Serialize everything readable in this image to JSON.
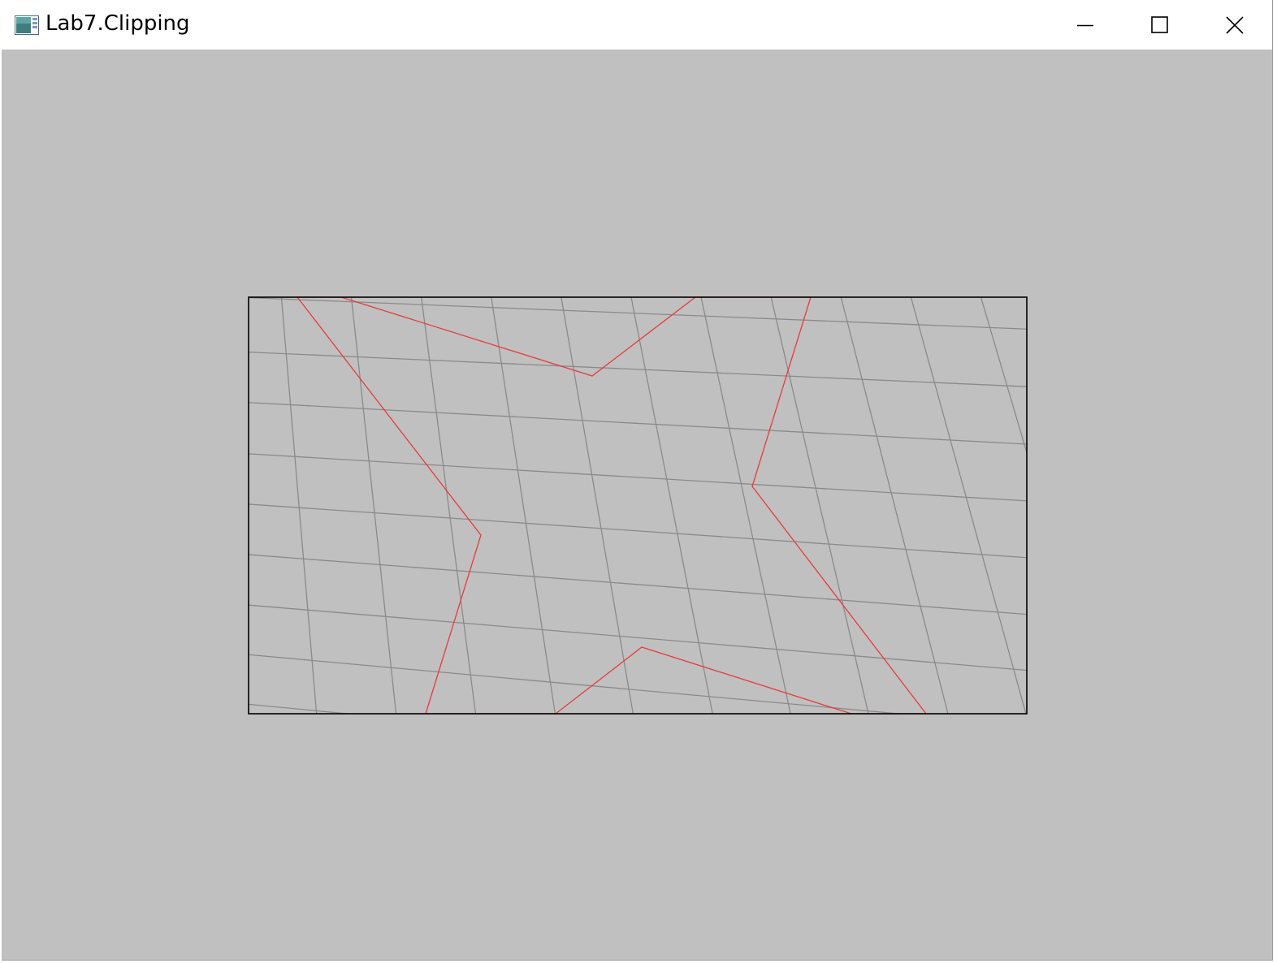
{
  "window": {
    "title": "Lab7.Clipping",
    "icon": "app-window-icon",
    "controls": {
      "minimize_icon": "minimize-icon",
      "maximize_icon": "maximize-icon",
      "close_icon": "close-icon"
    }
  },
  "colors": {
    "client_background": "#c0c0c0",
    "grid_lines": "#8a8a8a",
    "clipped_polygon": "#e83a3a",
    "clip_window_border": "#000000",
    "titlebar_background": "#ffffff"
  },
  "scene": {
    "description_type": "polygon clipping result rendered inside clip rectangle",
    "clip_window_visible": true,
    "grid_visible": true,
    "grid_lines_horizontal": 10,
    "grid_lines_vertical": 11
  }
}
